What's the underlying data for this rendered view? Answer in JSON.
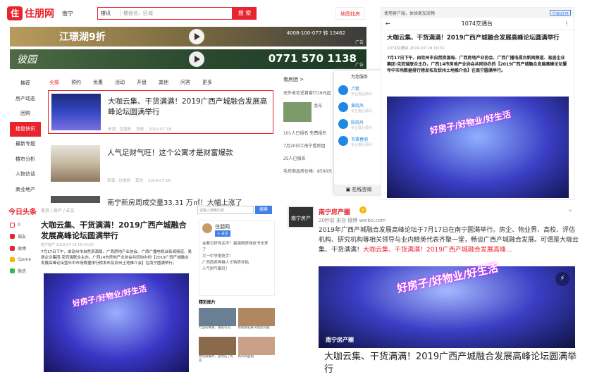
{
  "site": {
    "logo": "住朋网",
    "city": "南宁",
    "search_category": "楼讯",
    "search_placeholder": "楼盘名、区域",
    "search_button": "搜 索",
    "map_button": "地图找房"
  },
  "banners": {
    "b1_text": "江璟湖9折",
    "b1_phone": "4008-100-077 转 13462",
    "b1_tag": "广告",
    "b2_text": "彼园",
    "b2_phone": "0771 570 1138",
    "b2_tag": "广告"
  },
  "sidebar": [
    "推荐",
    "房产动态",
    "团购",
    "楼盘快讯",
    "最新专题",
    "楼市分析",
    "人物访谈",
    "商业地产"
  ],
  "tabs": [
    "全部",
    "预约",
    "优惠",
    "活动",
    "开盘",
    "其他",
    "问答",
    "更多"
  ],
  "feed": [
    {
      "title": "大咖云集、干货满满！2019广西产城融合发展高峰论坛圆满举行",
      "source": "来源：住朋网",
      "category": "其他",
      "date": "2019-07-18"
    },
    {
      "title": "人气足财气旺！这个公寓才是财富爆款",
      "source": "来源：住朋网",
      "category": "其他",
      "date": "2019-07-18"
    }
  ],
  "feed_partial": "南宁新房周成交量33.31 万㎡！大幅上涨了",
  "right_col": [
    "看房团 >",
    "无外收宅适首套行16元起",
    "龙光",
    "101人已报名  免费报名",
    "7月20日工南宁看房团",
    "25人已报名",
    "毛坯商品房价格：8500元"
  ],
  "service": {
    "header": "为您服务",
    "items": [
      {
        "name": "卢繁",
        "sub": "专业置业顾问"
      },
      {
        "name": "黄晓凤",
        "sub": "专业置业顾问"
      },
      {
        "name": "陈晓丹",
        "sub": "专业置业顾问"
      },
      {
        "name": "韦覃春丽",
        "sub": "专业置业顾问"
      }
    ],
    "online": "在线咨询"
  },
  "phone": {
    "top_text": "使用客户端，体验更加流畅",
    "open_btn": "立即打开",
    "nav_title": "1074交通台",
    "title": "大咖云集、干货满满！2019广西产城融合发展高峰论坛圆满举行",
    "meta": "1074交通台  2019-07-18 10:31",
    "body": "7月17日下午，由钦州市自然资源局、广西房地产业协会、广西广播电视台新闻频道、易居企业集团·克而瑞联合主办，广西14市房地产业协会共同协办的【2019广西产城融合发展高峰论坛暨年中市场数据排行榜发布及钦州土地推介会】在南宁圆满举行。",
    "stage": "好房子/好物业/好生活"
  },
  "toutiao": {
    "logo": "今日头条",
    "breadcrumb": "首页 / 房产 / 正文",
    "search_placeholder": "请输入搜索内容",
    "search_btn": "搜索",
    "side": [
      "0",
      "福友",
      "微博",
      "Qzone",
      "微信"
    ],
    "title": "大咖云集、干货满满！2019广西产城融合发展高峰论坛圆满举行",
    "meta": "南宁房产  2019-07-18 16:34:00",
    "body": "7月17日下午，由钦州市自然资源局、广西房地产业协会、广西广播电视台新闻频道、易居企业集团·克而瑞联合主办，广西14市房地产业协会共同协办的【2019广西产城融合发展高峰论坛暨年中市场数据排行榜发布及钦州土地推介会】在南宁圆满举行。",
    "author": "住朋网",
    "follow": "+ 关注",
    "related": [
      "会看打折你买不！最强购房绿皮书出来了",
      "又一中学很抢手！",
      "广西政府再推人才购房补贴",
      "人气财气都旺！"
    ],
    "pics_header": "精彩图片",
    "pic_caps": [
      "行业的尊重，随处可见",
      "帮助家庭解决住房问题",
      "曾经被嫌弃，居然成了好房",
      "城市新面貌"
    ]
  },
  "weibo": {
    "avatar_text": "南宁房产圈",
    "name": "南宁房产圈",
    "vip": "V",
    "time": "20秒前 来自 微博 weibo.com",
    "chevron": "⌄",
    "text": "2019年广西产城融合发展高峰论坛于7月17日在南宁圆满举行。房企、物业界、高校、评估机构、研究机构等相关领导与业内精英代表齐聚一堂，畅谈广西产城融合发展。可谓是大咖云集、干货满满！",
    "text_hl": "大咖云集、干货满满！2019广西产城融合发展高峰...",
    "img_tag": "南宁房产圈",
    "caption": "大咖云集、干货满满！2019广西产城融合发展高峰论坛圆满举行"
  }
}
